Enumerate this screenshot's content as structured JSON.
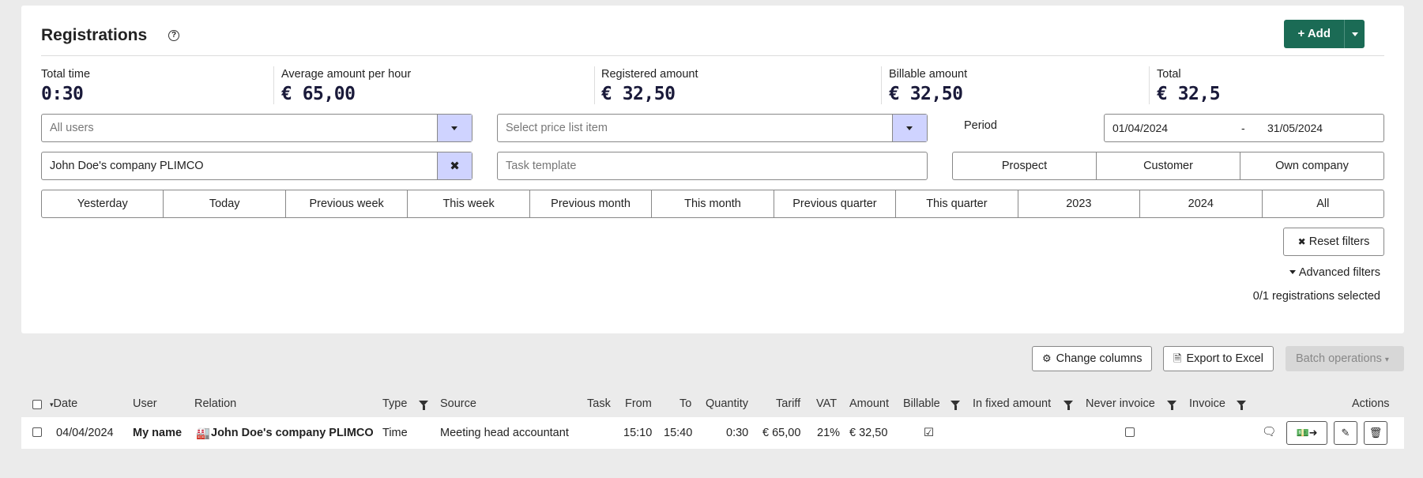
{
  "header": {
    "title": "Registrations",
    "help_icon": "?",
    "add_label": "+ Add"
  },
  "stats": [
    {
      "label": "Total time",
      "value": "0:30"
    },
    {
      "label": "Average amount per hour",
      "value": "€ 65,00"
    },
    {
      "label": "Registered amount",
      "value": "€ 32,50"
    },
    {
      "label": "Billable amount",
      "value": "€ 32,50"
    },
    {
      "label": "Total",
      "value": "€ 32,5"
    }
  ],
  "filters": {
    "users_placeholder": "All users",
    "price_item_placeholder": "Select price list item",
    "period_label": "Period",
    "date_from": "01/04/2024",
    "date_sep": "-",
    "date_to": "31/05/2024",
    "relation_value": "John Doe's company PLIMCO",
    "task_template_placeholder": "Task template",
    "relation_types": [
      "Prospect",
      "Customer",
      "Own company"
    ],
    "periods": [
      "Yesterday",
      "Today",
      "Previous week",
      "This week",
      "Previous month",
      "This month",
      "Previous quarter",
      "This quarter",
      "2023",
      "2024",
      "All"
    ],
    "reset_label": "Reset filters",
    "advanced_label": "Advanced filters",
    "selected_count": "0/1 registrations selected"
  },
  "toolbar": {
    "change_columns": "Change columns",
    "export_excel": "Export to Excel",
    "batch_operations": "Batch operations"
  },
  "table": {
    "headers": {
      "date": "Date",
      "user": "User",
      "relation": "Relation",
      "type": "Type",
      "source": "Source",
      "task": "Task",
      "from": "From",
      "to": "To",
      "quantity": "Quantity",
      "tariff": "Tariff",
      "vat": "VAT",
      "amount": "Amount",
      "billable": "Billable",
      "in_fixed_amount": "In fixed amount",
      "never_invoice": "Never invoice",
      "invoice": "Invoice",
      "actions": "Actions"
    },
    "rows": [
      {
        "date": "04/04/2024",
        "user": "My name",
        "relation": "John Doe's company PLIMCO",
        "type": "Time",
        "source": "Meeting head accountant",
        "from": "15:10",
        "to": "15:40",
        "quantity": "0:30",
        "tariff": "€ 65,00",
        "vat": "21%",
        "amount": "€ 32,50",
        "billable": true,
        "never_invoice": false
      }
    ]
  },
  "colors": {
    "brand": "#1b6b55",
    "select_side": "#cfd3ff"
  }
}
